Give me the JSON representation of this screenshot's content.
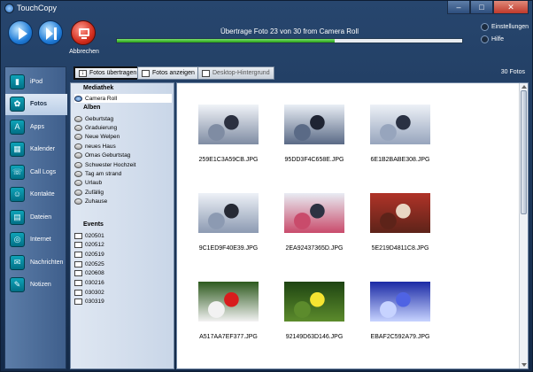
{
  "window": {
    "title": "TouchCopy",
    "controls": [
      "–",
      "□",
      "✕"
    ]
  },
  "toolbar": {
    "play_icon": "play-icon",
    "skip_icon": "skip-forward-icon",
    "abort_icon": "monitor-icon",
    "abort_label": "Abbrechen",
    "status_text": "Übertrage Foto 23 von 30 from Camera Roll",
    "progress": 0.63,
    "settings_label": "Einstellungen",
    "help_label": "Hilfe"
  },
  "sidebar": {
    "items": [
      {
        "label": "iPod",
        "icon": "ipod-icon"
      },
      {
        "label": "Fotos",
        "icon": "photos-icon",
        "active": true
      },
      {
        "label": "Apps",
        "icon": "apps-icon"
      },
      {
        "label": "Kalender",
        "icon": "calendar-icon"
      },
      {
        "label": "Call Logs",
        "icon": "phone-icon"
      },
      {
        "label": "Kontakte",
        "icon": "contacts-icon"
      },
      {
        "label": "Dateien",
        "icon": "files-icon"
      },
      {
        "label": "Internet",
        "icon": "globe-icon"
      },
      {
        "label": "Nachrichten",
        "icon": "messages-icon"
      },
      {
        "label": "Notizen",
        "icon": "notes-icon"
      }
    ]
  },
  "content_toolbar": {
    "transfer_label": "Fotos übertragen",
    "view_label": "Fotos anzeigen",
    "wallpaper_label": "Desktop-Hintergrund",
    "count": "30 Fotos"
  },
  "tree": {
    "library_header": "Mediathek",
    "camera_roll": "Camera Roll",
    "albums_header": "Alben",
    "albums": [
      "Geburtstag",
      "Graduierung",
      "Neue Welpen",
      "neues Haus",
      "Omas Geburtstag",
      "Schwester Hochzeit",
      "Tag am strand",
      "Urlaub",
      "Zufällig",
      "Zuhause"
    ],
    "events_header": "Events",
    "events": [
      "020501",
      "020512",
      "020519",
      "020525",
      "020608",
      "030216",
      "030302",
      "030319"
    ]
  },
  "gallery": {
    "photos": [
      {
        "name": "259E1C3A59CB.JPG",
        "colors": [
          "#f0f3f8",
          "#2b3040",
          "#7f8ca3"
        ]
      },
      {
        "name": "95DD3F4C658E.JPG",
        "colors": [
          "#e9eef5",
          "#1f2433",
          "#5a6a86"
        ]
      },
      {
        "name": "6E1B2BABE308.JPG",
        "colors": [
          "#edf1f7",
          "#2a3143",
          "#97a5bd"
        ]
      },
      {
        "name": "9C1ED9F40E39.JPG",
        "colors": [
          "#edf1f7",
          "#262a35",
          "#8c9ab2"
        ]
      },
      {
        "name": "2EA92437365D.JPG",
        "colors": [
          "#e8ecf3",
          "#2d3242",
          "#c94b6b"
        ]
      },
      {
        "name": "5E219D4811C8.JPG",
        "colors": [
          "#b03328",
          "#e9d6c3",
          "#5d2319"
        ]
      },
      {
        "name": "A517AA7EF377.JPG",
        "colors": [
          "#2d5a1e",
          "#d81d1d",
          "#f2f2f2"
        ]
      },
      {
        "name": "92149D63D146.JPG",
        "colors": [
          "#1e4412",
          "#f5e431",
          "#5c8b2c"
        ]
      },
      {
        "name": "EBAF2C592A79.JPG",
        "colors": [
          "#1b2aa5",
          "#4f63e3",
          "#c7d3ff"
        ]
      }
    ]
  }
}
